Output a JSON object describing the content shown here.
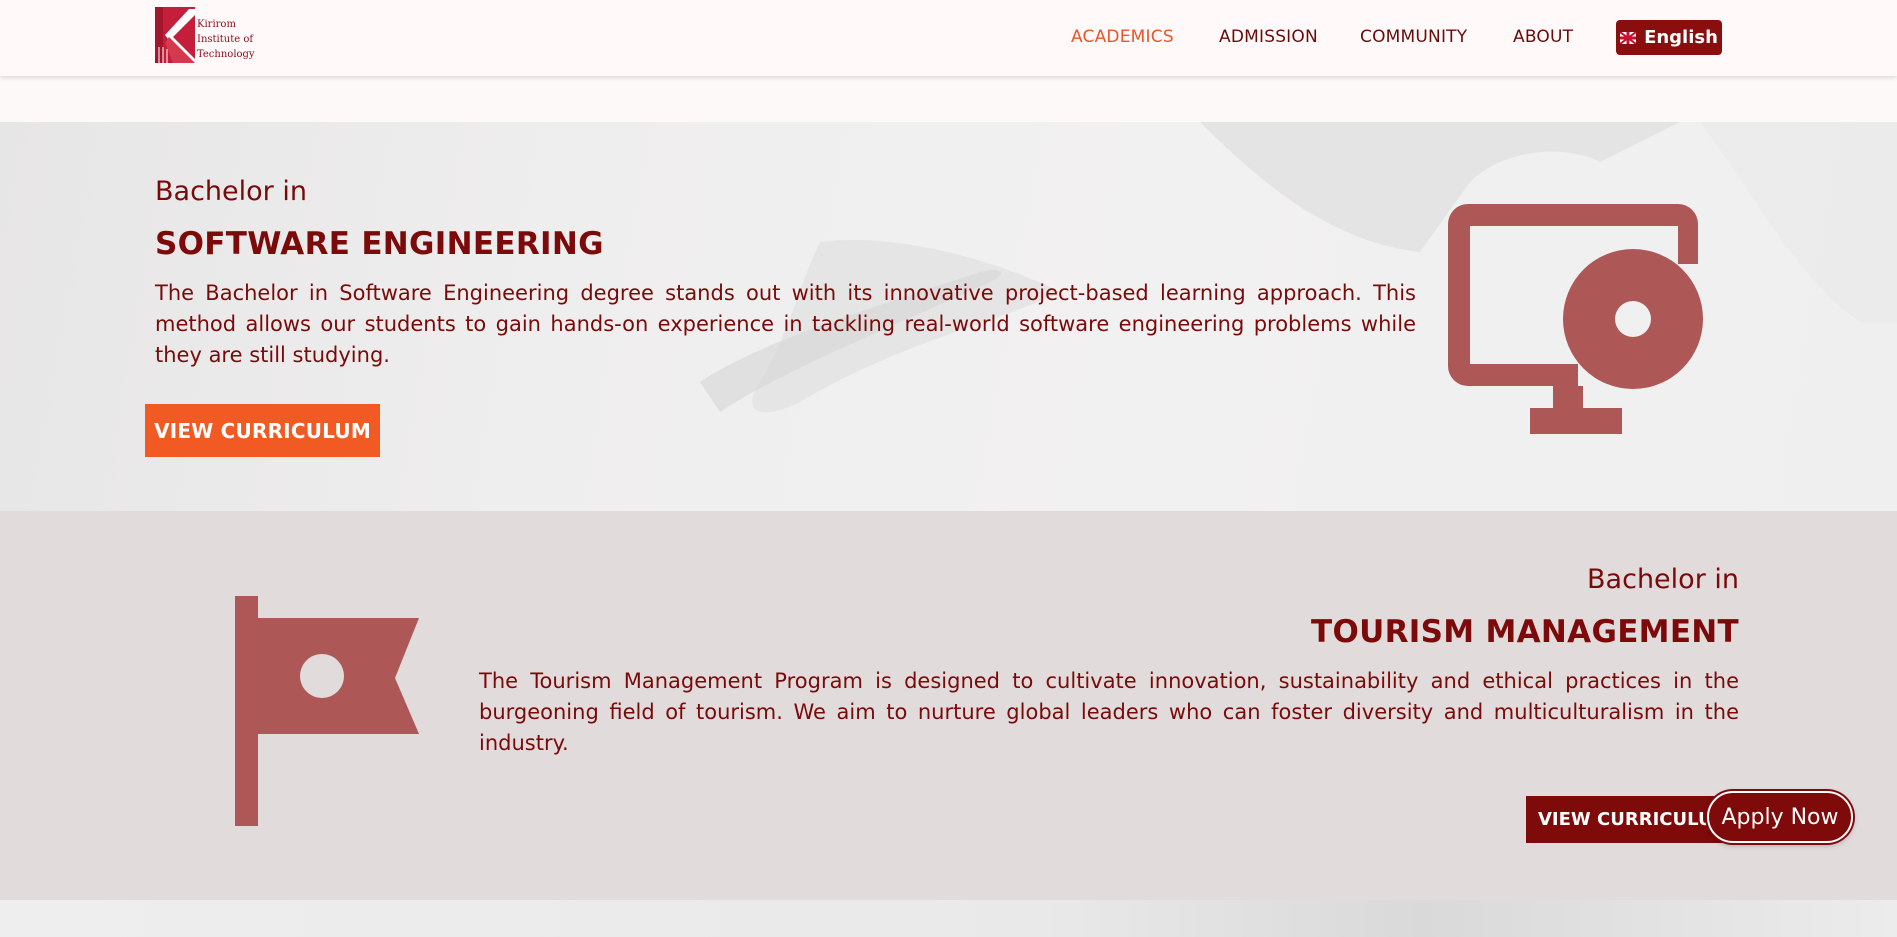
{
  "header": {
    "logo_lines": [
      "Kirirom",
      "Institute of",
      "Technology"
    ],
    "nav": [
      {
        "label": "ACADEMICS",
        "active": true
      },
      {
        "label": "ADMISSION",
        "active": false
      },
      {
        "label": "COMMUNITY",
        "active": false
      },
      {
        "label": "ABOUT",
        "active": false
      }
    ],
    "language_label": "English"
  },
  "programs": [
    {
      "pre": "Bachelor in",
      "title": "SOFTWARE ENGINEERING",
      "description": "The Bachelor in Software Engineering degree stands out with its innovative project-based learning approach. This method allows our students to gain hands-on experience in tackling real-world software engineering problems while they are still studying.",
      "button": "VIEW CURRICULUM",
      "icon": "monitor-disc-icon"
    },
    {
      "pre": "Bachelor in",
      "title": "TOURISM MANAGEMENT",
      "description": "The Tourism Management Program is designed to cultivate innovation, sustainability and ethical practices in the burgeoning field of tourism. We aim to nurture global leaders who can foster diversity and multiculturalism in the industry.",
      "button": "VIEW CURRICULUM",
      "icon": "flag-icon"
    }
  ],
  "apply_now": "Apply Now",
  "colors": {
    "brand_dark_red": "#7e0a0a",
    "accent_orange": "#f15a22",
    "icon_red": "#ad5757"
  }
}
